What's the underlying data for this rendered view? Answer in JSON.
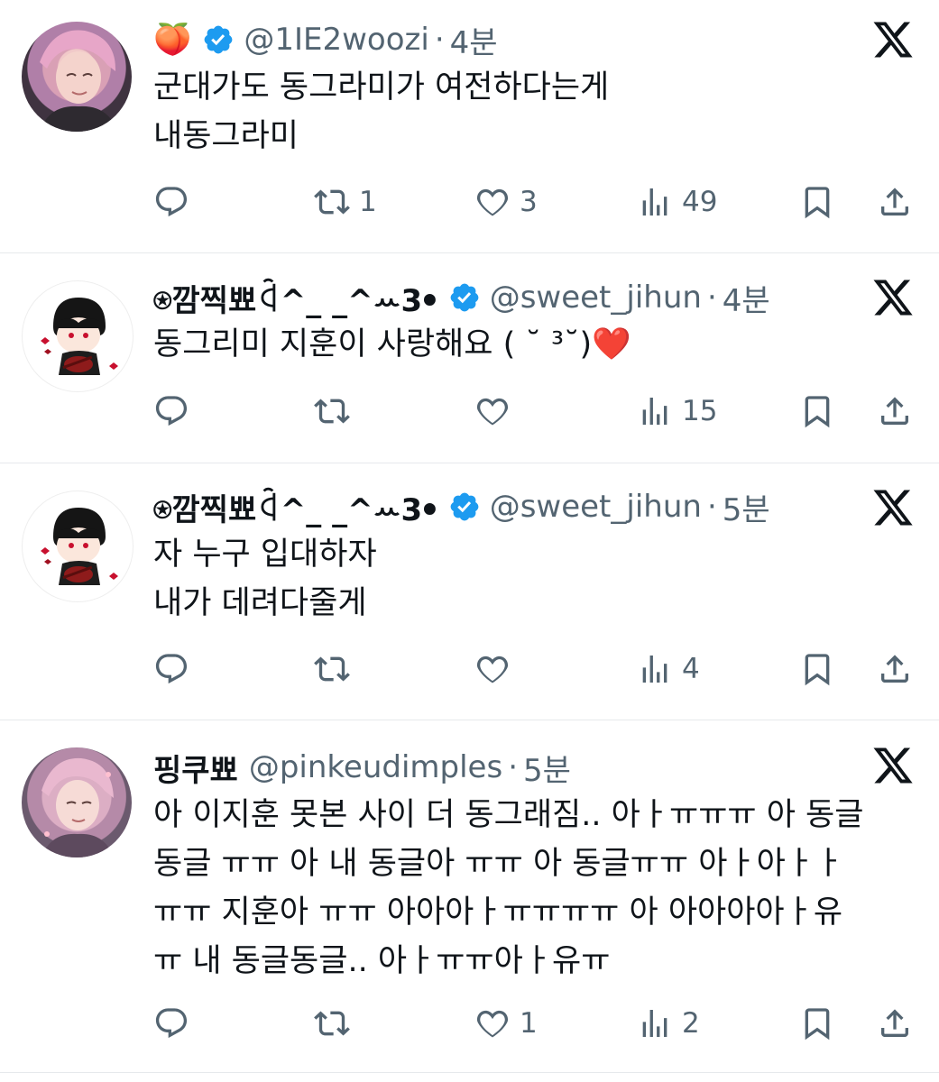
{
  "tweets": [
    {
      "avatar": "pink-hair-avatar",
      "name_emoji": "🍑",
      "name": "",
      "verified": true,
      "handle": "@1IE2woozi",
      "dot": "·",
      "time": "4분",
      "lines": [
        "군대가도 동그라미가 여전하다는게",
        "내동그라미"
      ],
      "reply_count": "",
      "retweet_count": "1",
      "like_count": "3",
      "view_count": "49"
    },
    {
      "avatar": "chibi-avatar",
      "name_emoji": "",
      "name": "⍟깜찍뾰ꒈ^_ _^ꕀ3ꔷ",
      "verified": true,
      "handle": "@sweet_jihun",
      "dot": "·",
      "time": "4분",
      "lines": [
        "동그리미 지훈이 사랑해요 ( ˘ ³˘)❤️"
      ],
      "reply_count": "",
      "retweet_count": "",
      "like_count": "",
      "view_count": "15"
    },
    {
      "avatar": "chibi-avatar",
      "name_emoji": "",
      "name": "⍟깜찍뾰ꒈ^_ _^ꕀ3ꔷ",
      "verified": true,
      "handle": "@sweet_jihun",
      "dot": "·",
      "time": "5분",
      "lines": [
        "자 누구 입대하자",
        "내가 데려다줄게"
      ],
      "reply_count": "",
      "retweet_count": "",
      "like_count": "",
      "view_count": "4"
    },
    {
      "avatar": "pink-hair-avatar-2",
      "name_emoji": "",
      "name": "핑쿠뾰",
      "verified": false,
      "handle": "@pinkeudimples",
      "dot": "·",
      "time": "5분",
      "lines": [
        "아 이지훈 못본 사이 더 동그래짐.. 아ㅏㅠㅠㅠ 아 동글",
        "동글 ㅠㅠ 아 내 동글아 ㅠㅠ 아 동글ㅠㅠ 아ㅏ아ㅏㅏ",
        "ㅠㅠ 지훈아 ㅠㅠ 아아아ㅏㅠㅠㅠㅠ 아 아아아아ㅏ유",
        "ㅠ 내 동글동글.. 아ㅏㅠㅠ아ㅏ유ㅠ"
      ],
      "reply_count": "",
      "retweet_count": "",
      "like_count": "1",
      "view_count": "2"
    }
  ],
  "colors": {
    "verified": "#1d9bf0",
    "text": "#0f1419",
    "muted": "#536471",
    "divider": "#e6e9ec"
  }
}
